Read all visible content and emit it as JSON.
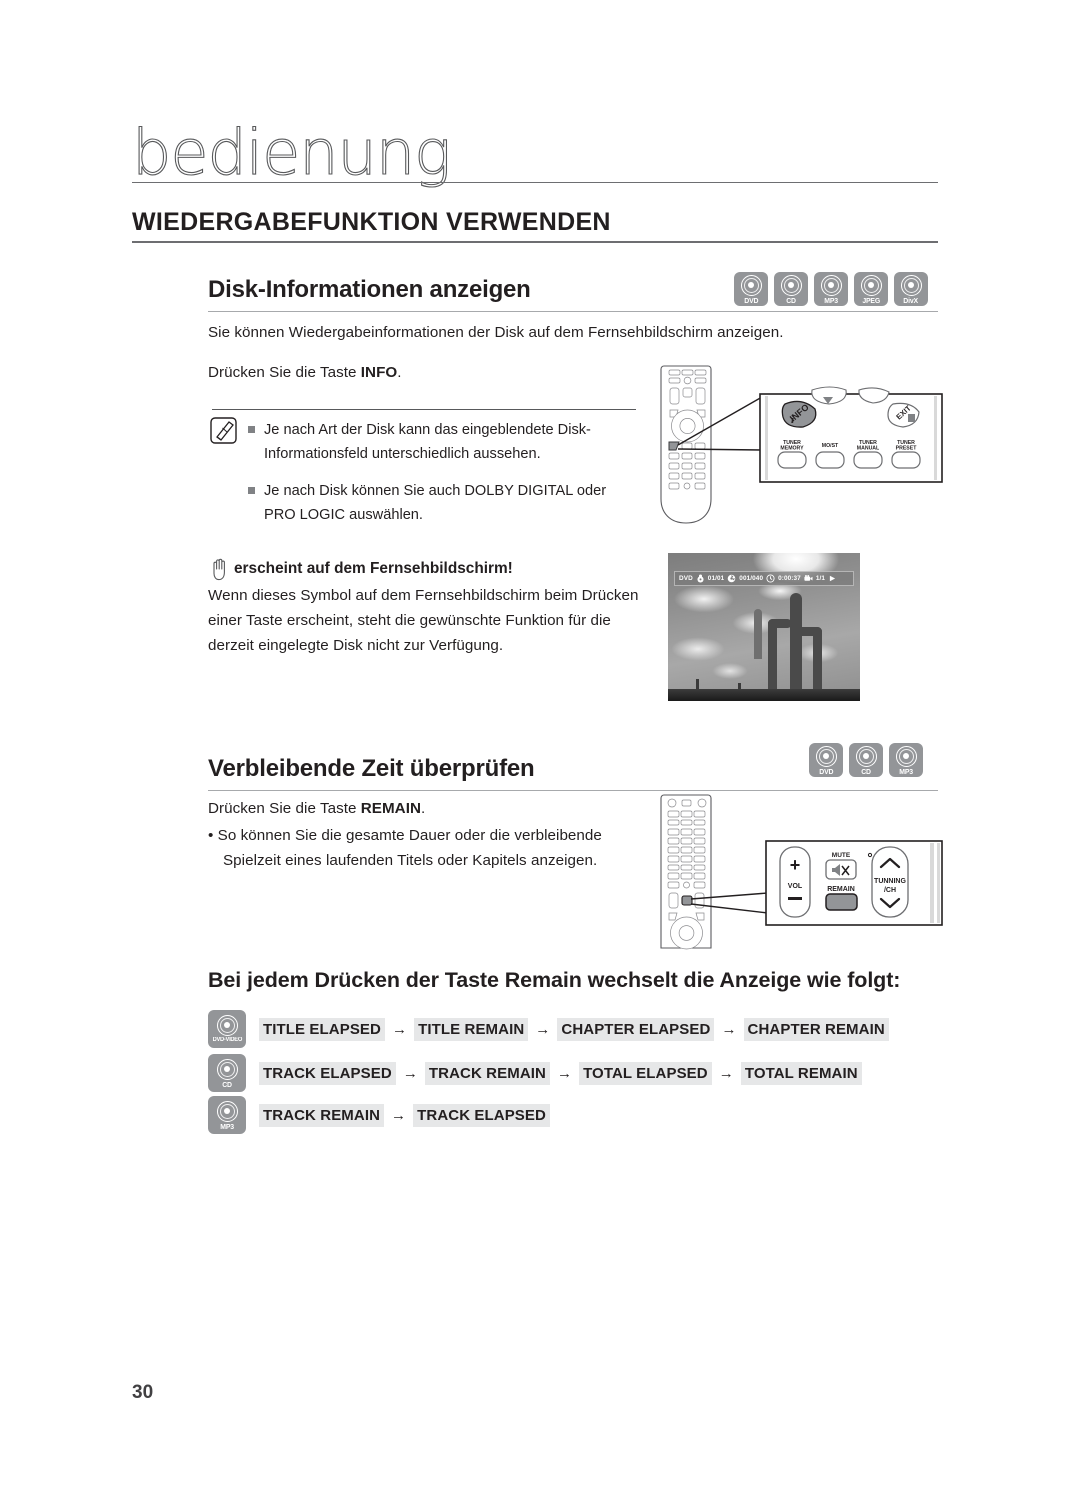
{
  "chapter": {
    "title": "bedienung"
  },
  "section": {
    "h1": "WIEDERGABEFUNKTION VERWENDEN"
  },
  "page": {
    "number": "30"
  },
  "disk_info": {
    "h2": "Disk-Informationen anzeigen",
    "badges": [
      {
        "label": "DVD"
      },
      {
        "label": "CD"
      },
      {
        "label": "MP3"
      },
      {
        "label": "JPEG"
      },
      {
        "label": "DivX"
      }
    ],
    "intro": "Sie können Wiedergabeinformationen der Disk auf dem Fernsehbildschirm anzeigen.",
    "instruction_prefix": "Drücken Sie die Taste ",
    "instruction_key": "INFO",
    "instruction_suffix": ".",
    "notes": [
      "Je nach Art der Disk kann das eingeblendete Disk-Informationsfeld unterschiedlich aussehen.",
      "Je nach Disk können Sie auch DOLBY DIGITAL oder PRO LOGIC auswählen."
    ],
    "warning_title": "erscheint auf dem Fernsehbildschirm!",
    "warning_body": "Wenn dieses Symbol auf dem Fernsehbildschirm beim Drücken einer Taste erscheint, steht die gewünschte Funktion für die derzeit eingelegte Disk nicht zur Verfügung.",
    "remote_callout": {
      "highlighted_button": "INFO",
      "exit_button": "EXIT",
      "buttons": [
        "TUNER MEMORY",
        "MO/ST",
        "TUNER MANUAL",
        "TUNER PRESET"
      ]
    },
    "osd": {
      "disc_type": "DVD",
      "title": "01/01",
      "chapter": "001/040",
      "time": "0:00:37",
      "angle": "1/1"
    }
  },
  "remaining_time": {
    "h2": "Verbleibende Zeit überprüfen",
    "badges": [
      {
        "label": "DVD"
      },
      {
        "label": "CD"
      },
      {
        "label": "MP3"
      }
    ],
    "instruction_prefix": "Drücken Sie die Taste ",
    "instruction_key": "REMAIN",
    "instruction_suffix": ".",
    "bullet": "So können Sie die gesamte Dauer oder die verbleibende Spielzeit eines laufenden Titels oder Kapitels anzeigen.",
    "remote_callout": {
      "highlighted_button": "REMAIN",
      "vol_label": "VOL",
      "vol_plus": "+",
      "vol_minus": "−",
      "mute_label": "MUTE",
      "tuning_label_1": "TUNNING",
      "tuning_label_2": "/CH"
    }
  },
  "sequence": {
    "heading": "Bei jedem Drücken der Taste Remain wechselt die Anzeige wie folgt:",
    "arrow": "→",
    "rows": [
      {
        "badge": "DVD-VIDEO",
        "items": [
          "TITLE ELAPSED",
          "TITLE REMAIN",
          "CHAPTER ELAPSED",
          "CHAPTER REMAIN"
        ]
      },
      {
        "badge": "CD",
        "items": [
          "TRACK ELAPSED",
          "TRACK REMAIN",
          "TOTAL ELAPSED",
          "TOTAL REMAIN"
        ]
      },
      {
        "badge": "MP3",
        "items": [
          "TRACK REMAIN",
          "TRACK ELAPSED"
        ]
      }
    ]
  }
}
